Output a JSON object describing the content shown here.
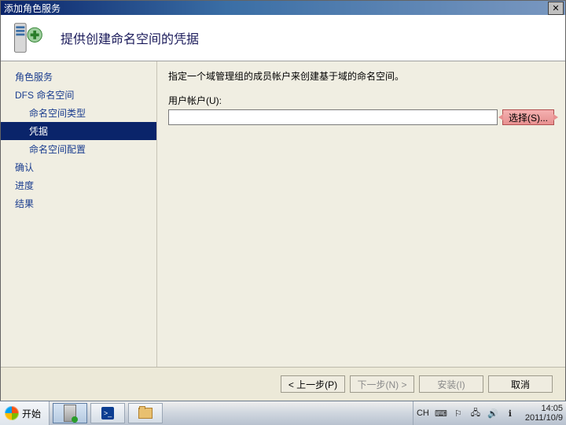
{
  "window_title": "添加角色服务",
  "header": {
    "title": "提供创建命名空间的凭据"
  },
  "sidebar": {
    "items": [
      {
        "label": "角色服务",
        "indent": 0,
        "selected": false,
        "name": "role-services"
      },
      {
        "label": "DFS 命名空间",
        "indent": 0,
        "selected": false,
        "name": "dfs-namespace"
      },
      {
        "label": "命名空间类型",
        "indent": 1,
        "selected": false,
        "name": "namespace-type"
      },
      {
        "label": "凭据",
        "indent": 1,
        "selected": true,
        "name": "credentials"
      },
      {
        "label": "命名空间配置",
        "indent": 1,
        "selected": false,
        "name": "namespace-config"
      },
      {
        "label": "确认",
        "indent": 0,
        "selected": false,
        "name": "confirm"
      },
      {
        "label": "进度",
        "indent": 0,
        "selected": false,
        "name": "progress"
      },
      {
        "label": "结果",
        "indent": 0,
        "selected": false,
        "name": "result"
      }
    ]
  },
  "main": {
    "instruction": "指定一个域管理组的成员帐户来创建基于域的命名空间。",
    "account_label": "用户帐户(U):",
    "account_value": "",
    "select_button": "选择(S)..."
  },
  "footer": {
    "prev": "< 上一步(P)",
    "next": "下一步(N) >",
    "install": "安装(I)",
    "cancel": "取消"
  },
  "taskbar": {
    "start": "开始",
    "ime": "CH",
    "time": "14:05",
    "date": "2011/10/9"
  }
}
